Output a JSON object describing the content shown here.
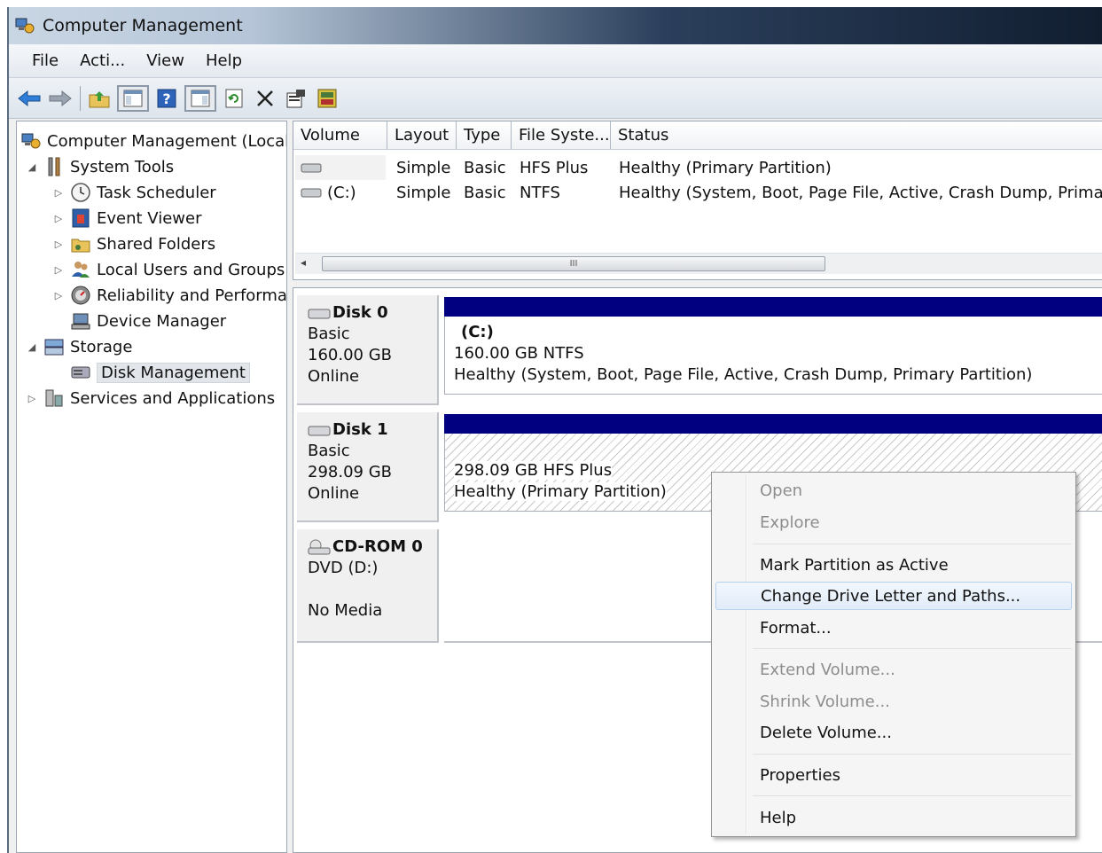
{
  "window": {
    "title": "Computer Management"
  },
  "menubar": [
    "File",
    "Acti...",
    "View",
    "Help"
  ],
  "toolbar": {
    "icons": [
      "back-arrow-icon",
      "forward-arrow-icon",
      "up-folder-icon",
      "show-hide-tree-icon",
      "help-icon",
      "show-hide-action-pane-icon",
      "refresh-icon",
      "delete-icon",
      "properties-icon",
      "disk-props-icon"
    ]
  },
  "tree": {
    "root": "Computer Management (Local",
    "system_tools": "System Tools",
    "task_scheduler": "Task Scheduler",
    "event_viewer": "Event Viewer",
    "shared_folders": "Shared Folders",
    "local_users": "Local Users and Groups",
    "reliability": "Reliability and Performa",
    "device_manager": "Device Manager",
    "storage": "Storage",
    "disk_management": "Disk Management",
    "services": "Services and Applications"
  },
  "volume_list": {
    "headers": [
      "Volume",
      "Layout",
      "Type",
      "File Syste...",
      "Status"
    ],
    "rows": [
      {
        "volume": "",
        "layout": "Simple",
        "type": "Basic",
        "fs": "HFS Plus",
        "status": "Healthy (Primary Partition)"
      },
      {
        "volume": "(C:)",
        "layout": "Simple",
        "type": "Basic",
        "fs": "NTFS",
        "status": "Healthy (System, Boot, Page File, Active, Crash Dump, Primary Partition)"
      }
    ],
    "scroll_grip": "III"
  },
  "disks": [
    {
      "name": "Disk 0",
      "kind": "Basic",
      "size": "160.00 GB",
      "state": "Online",
      "partition": {
        "label": "(C:)",
        "size_fs": "160.00 GB NTFS",
        "status": "Healthy (System, Boot, Page File, Active, Crash Dump, Primary Partition)"
      }
    },
    {
      "name": "Disk 1",
      "kind": "Basic",
      "size": "298.09 GB",
      "state": "Online",
      "partition": {
        "label": "",
        "size_fs": "298.09 GB HFS Plus",
        "status": "Healthy (Primary Partition)"
      }
    },
    {
      "name": "CD-ROM 0",
      "kind": "DVD (D:)",
      "size": "",
      "state": "No Media"
    }
  ],
  "context_menu": {
    "items": [
      {
        "label": "Open",
        "enabled": false
      },
      {
        "label": "Explore",
        "enabled": false
      },
      {
        "label": "Mark Partition as Active",
        "enabled": true
      },
      {
        "label": "Change Drive Letter and Paths...",
        "enabled": true,
        "highlighted": true
      },
      {
        "label": "Format...",
        "enabled": true
      },
      {
        "label": "Extend Volume...",
        "enabled": false
      },
      {
        "label": "Shrink Volume...",
        "enabled": false
      },
      {
        "label": "Delete Volume...",
        "enabled": true
      },
      {
        "label": "Properties",
        "enabled": true
      },
      {
        "label": "Help",
        "enabled": true
      }
    ]
  },
  "colors": {
    "partition_bar": "#000080",
    "menu_highlight": "#e1ecf9"
  }
}
